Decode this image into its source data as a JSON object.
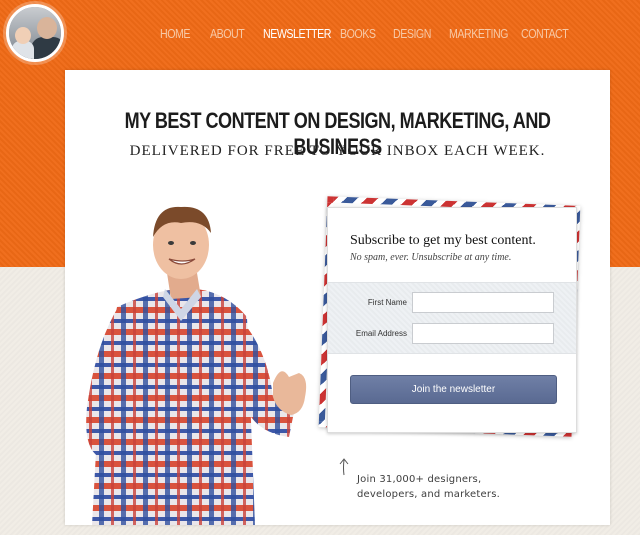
{
  "nav": {
    "items": [
      "HOME",
      "ABOUT",
      "NEWSLETTER",
      "BOOKS",
      "DESIGN",
      "MARKETING",
      "CONTACT"
    ],
    "active": "NEWSLETTER"
  },
  "hero": {
    "headline": "MY BEST CONTENT ON DESIGN, MARKETING, AND BUSINESS",
    "subhead": "DELIVERED FOR FREE TO YOUR INBOX EACH WEEK."
  },
  "signup": {
    "title": "Subscribe to get my best content.",
    "note": "No spam, ever. Unsubscribe at any time.",
    "first_name_label": "First Name",
    "first_name_value": "",
    "email_label": "Email Address",
    "email_value": "",
    "button_label": "Join the newsletter"
  },
  "social_proof": {
    "line1": "Join 31,000+ designers,",
    "line2": "developers, and marketers."
  },
  "colors": {
    "brand_orange": "#f06a16",
    "button_blue": "#5f6f97"
  }
}
